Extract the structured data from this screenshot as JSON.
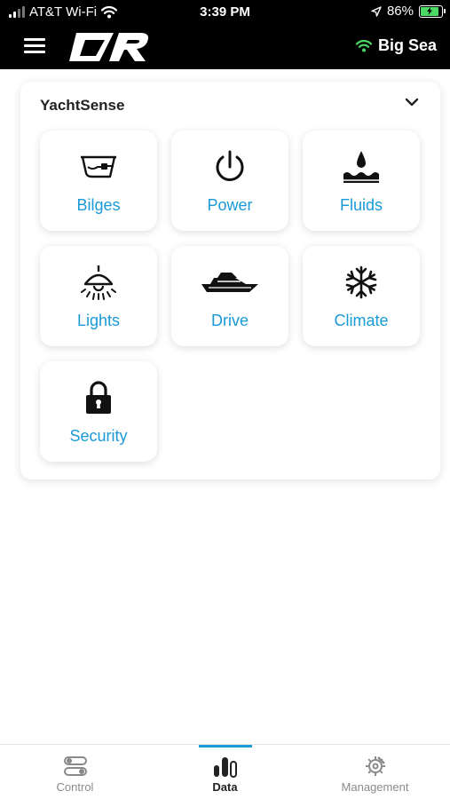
{
  "status_bar": {
    "carrier": "AT&T Wi-Fi",
    "time": "3:39 PM",
    "battery": "86%",
    "battery_level": 0.86
  },
  "header": {
    "menu_icon": "hamburger-menu-icon",
    "logo_icon": "raymarine-logo-icon",
    "connection_icon": "wifi-icon",
    "connection_name": "Big Sea"
  },
  "card": {
    "title": "YachtSense",
    "tiles": [
      {
        "label": "Bilges",
        "icon": "bilge-icon"
      },
      {
        "label": "Power",
        "icon": "power-icon"
      },
      {
        "label": "Fluids",
        "icon": "fluid-drop-icon"
      },
      {
        "label": "Lights",
        "icon": "light-icon"
      },
      {
        "label": "Drive",
        "icon": "yacht-icon"
      },
      {
        "label": "Climate",
        "icon": "snowflake-icon"
      },
      {
        "label": "Security",
        "icon": "padlock-icon"
      }
    ]
  },
  "bottom_nav": {
    "items": [
      {
        "label": "Control",
        "icon": "control-toggles-icon"
      },
      {
        "label": "Data",
        "icon": "data-bars-icon",
        "active": true
      },
      {
        "label": "Management",
        "icon": "gear-wrench-icon"
      }
    ]
  },
  "colors": {
    "accent": "#1a9ad6",
    "header_bg": "#000000",
    "wifi_green": "#4cd964",
    "battery_green": "#4cd964"
  }
}
